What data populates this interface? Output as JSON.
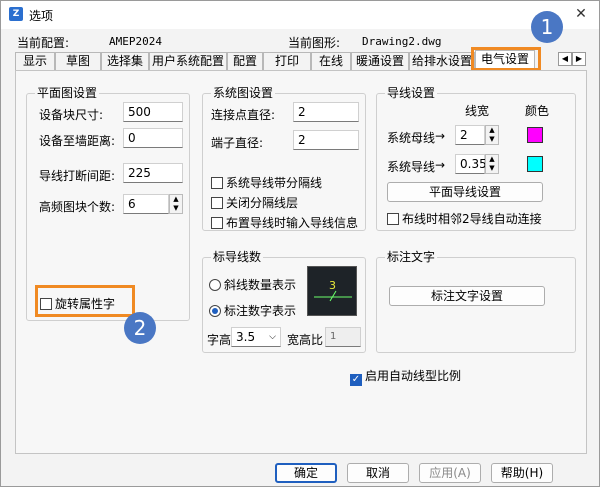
{
  "window": {
    "title": "选项",
    "app_icon": "zw-app-icon"
  },
  "config": {
    "current_config_label": "当前配置:",
    "current_config_value": "AMEP2024",
    "current_drawing_label": "当前图形:",
    "current_drawing_value": "Drawing2.dwg"
  },
  "tabs": [
    "显示",
    "草图",
    "选择集",
    "用户系统配置",
    "配置",
    "打印",
    "在线",
    "暖通设置",
    "给排水设置",
    "电气设置"
  ],
  "active_tab": "电气设置",
  "plan": {
    "title": "平面图设置",
    "fields": [
      {
        "label": "设备块尺寸:",
        "value": "500"
      },
      {
        "label": "设备至墙距离:",
        "value": "0"
      },
      {
        "label": "导线打断间距:",
        "value": "225"
      },
      {
        "label": "高频图块个数:",
        "value": "6"
      }
    ],
    "rotate_attr": {
      "label": "旋转属性字",
      "checked": false
    }
  },
  "system": {
    "title": "系统图设置",
    "fields": [
      {
        "label": "连接点直径:",
        "value": "2"
      },
      {
        "label": "端子直径:",
        "value": "2"
      }
    ],
    "checks": [
      {
        "label": "系统导线带分隔线",
        "checked": false
      },
      {
        "label": "关闭分隔线层",
        "checked": false
      },
      {
        "label": "布置导线时输入导线信息",
        "checked": false
      }
    ]
  },
  "wire": {
    "title": "导线设置",
    "col_width": "线宽",
    "col_color": "颜色",
    "rows": [
      {
        "label": "系统母线",
        "arrow": "→",
        "value": "2",
        "color": "#ff00ff"
      },
      {
        "label": "系统导线",
        "arrow": "→",
        "value": "0.35",
        "color": "#00ffff"
      }
    ],
    "plan_wire_button": "平面导线设置",
    "auto_connect": {
      "label": "布线时相邻2导线自动连接",
      "checked": false
    }
  },
  "mark_wire": {
    "title": "标导线数",
    "options": [
      {
        "label": "斜线数量表示",
        "selected": false
      },
      {
        "label": "标注数字表示",
        "selected": true
      }
    ],
    "preview_number": "3",
    "height_label": "字高",
    "height_value": "3.5",
    "ratio_label": "宽高比",
    "ratio_value": "1"
  },
  "mark_text": {
    "title": "标注文字",
    "button": "标注文字设置"
  },
  "auto_linetype": {
    "label": "启用自动线型比例",
    "checked": true
  },
  "footer": {
    "ok": "确定",
    "cancel": "取消",
    "apply": "应用(A)",
    "help": "帮助(H)"
  },
  "callouts": [
    "1",
    "2"
  ],
  "colors": {
    "highlight": "#f08a23",
    "badge": "#4a77c4",
    "accent": "#1f5fbf"
  }
}
